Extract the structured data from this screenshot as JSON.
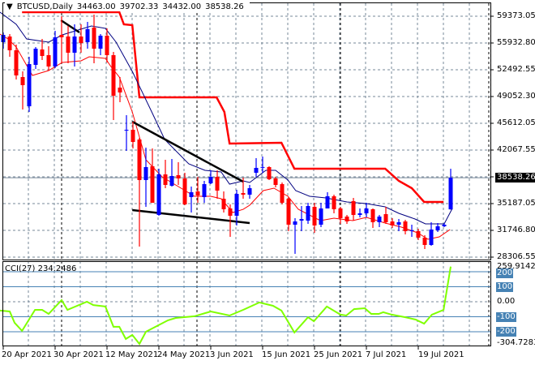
{
  "header": {
    "symbol": "BTCUSD,Daily",
    "open": "34463.00",
    "high": "39702.33",
    "low": "34432.00",
    "close": "38538.26"
  },
  "cci_label": {
    "name": "CCI(27)",
    "value": "234.2486"
  },
  "price_axis": [
    "59373.05",
    "55932.80",
    "52492.55",
    "49052.30",
    "45612.05",
    "42067.55",
    "35187.05",
    "31746.80",
    "28306.55"
  ],
  "current_price": "38538.26",
  "cci_axis": {
    "max": "259.9142",
    "min": "-304.7283",
    "levels": [
      "200",
      "100",
      "0.00",
      "-100",
      "-200"
    ]
  },
  "date_axis": [
    "20 Apr 2021",
    "30 Apr 2021",
    "12 May 2021",
    "24 May 2021",
    "3 Jun 2021",
    "15 Jun 2021",
    "25 Jun 2021",
    "7 Jul 2021",
    "19 Jul 2021"
  ],
  "colors": {
    "bull": "#0000ff",
    "bear": "#ff0000",
    "ma_fast": "#000080",
    "ma_slow": "#ff0000",
    "stop": "#ff0000",
    "cci": "#7fff00",
    "level": "#4682b4"
  },
  "chart_data": {
    "type": "candlestick",
    "title": "BTCUSD,Daily",
    "ylim": [
      28306.55,
      59373.05
    ],
    "candles": [
      [
        56026,
        57281,
        55189,
        56967
      ],
      [
        56758,
        57072,
        54143,
        54980
      ],
      [
        54980,
        55712,
        51214,
        51737
      ],
      [
        51528,
        52260,
        47344,
        50482
      ],
      [
        47762,
        54143,
        47030,
        53202
      ],
      [
        53097,
        55398,
        52574,
        55189
      ],
      [
        55084,
        56444,
        53725,
        54248
      ],
      [
        54352,
        55503,
        52365,
        52888
      ],
      [
        52888,
        57490,
        52679,
        56653
      ],
      [
        56967,
        59373,
        53306,
        56653
      ],
      [
        56758,
        58118,
        53306,
        54666
      ],
      [
        54666,
        58327,
        52888,
        56758
      ],
      [
        56758,
        58327,
        54666,
        55921
      ],
      [
        56026,
        58641,
        55189,
        57699
      ],
      [
        57909,
        59582,
        53306,
        55189
      ],
      [
        55189,
        57072,
        54352,
        56862
      ],
      [
        56862,
        57804,
        53411,
        54352
      ],
      [
        54352,
        54771,
        45985,
        49122
      ],
      [
        50168,
        51528,
        48285,
        49541
      ],
      [
        44624,
        46612,
        42009,
        44729
      ],
      [
        44729,
        45775,
        42323,
        43160
      ],
      [
        43474,
        43683,
        29667,
        38244
      ],
      [
        38244,
        42428,
        34792,
        39918
      ],
      [
        40022,
        42323,
        35315,
        35315
      ],
      [
        33746,
        39708,
        33641,
        38976
      ],
      [
        38976,
        40859,
        37198,
        37616
      ],
      [
        37511,
        40963,
        37407,
        38767
      ],
      [
        38871,
        40545,
        37616,
        38453
      ],
      [
        38453,
        39185,
        35001,
        35106
      ],
      [
        36047,
        37407,
        34060,
        36675
      ],
      [
        36779,
        38662,
        35315,
        36257
      ],
      [
        36047,
        38139,
        35315,
        37720
      ],
      [
        37825,
        39499,
        37720,
        38662
      ],
      [
        38662,
        39499,
        35838,
        36884
      ],
      [
        35838,
        36779,
        34060,
        34480
      ],
      [
        34583,
        35106,
        30922,
        33641
      ],
      [
        33641,
        36989,
        32386,
        36466
      ],
      [
        36570,
        38557,
        35838,
        36361
      ],
      [
        36361,
        37616,
        35838,
        37198
      ],
      [
        39185,
        41068,
        38662,
        39813
      ],
      [
        39918,
        41277,
        39185,
        39930
      ],
      [
        39918,
        40022,
        38244,
        38348
      ],
      [
        38453,
        38662,
        37302,
        37616
      ],
      [
        37720,
        37930,
        35106,
        35315
      ],
      [
        35838,
        36047,
        31654,
        32491
      ],
      [
        32491,
        33328,
        28730,
        32909
      ],
      [
        33014,
        34897,
        31654,
        33223
      ],
      [
        33014,
        35315,
        32595,
        34897
      ],
      [
        34792,
        35315,
        31445,
        32386
      ],
      [
        32491,
        35315,
        32177,
        34583
      ],
      [
        34583,
        36675,
        34583,
        36152
      ],
      [
        36152,
        36361,
        33955,
        34478
      ],
      [
        34583,
        34792,
        32595,
        33328
      ],
      [
        33537,
        33746,
        32595,
        32909
      ],
      [
        35524,
        35943,
        33014,
        33746
      ],
      [
        33746,
        34583,
        33432,
        33955
      ],
      [
        33955,
        35315,
        33432,
        34583
      ],
      [
        34478,
        34583,
        32073,
        32805
      ],
      [
        32805,
        33746,
        32177,
        33537
      ],
      [
        33851,
        34792,
        32595,
        32805
      ],
      [
        32909,
        33328,
        32073,
        32386
      ],
      [
        32491,
        33223,
        31654,
        32805
      ],
      [
        32909,
        33119,
        31236,
        31654
      ],
      [
        31654,
        32491,
        30922,
        31759
      ],
      [
        31654,
        31968,
        30504,
        30818
      ],
      [
        30818,
        31131,
        29353,
        29877
      ],
      [
        29877,
        32805,
        29772,
        31863
      ],
      [
        31759,
        32700,
        31550,
        32282
      ],
      [
        32282,
        32700,
        32177,
        32491
      ],
      [
        34463,
        39702.33,
        34432,
        38538.26
      ]
    ],
    "ma_fast": [
      [
        -0.5,
        59896
      ],
      [
        2,
        58327
      ],
      [
        3.6,
        56444
      ],
      [
        7,
        56026
      ],
      [
        9.1,
        56967
      ],
      [
        13.6,
        58118
      ],
      [
        15.75,
        57804
      ],
      [
        17.4,
        56026
      ],
      [
        19.9,
        52260
      ],
      [
        22.9,
        47030
      ],
      [
        24.9,
        43474
      ],
      [
        28.6,
        40336
      ],
      [
        31.1,
        39499
      ],
      [
        33.6,
        39290
      ],
      [
        34.9,
        37720
      ],
      [
        37,
        38139
      ],
      [
        38,
        37930
      ],
      [
        40.5,
        39499
      ],
      [
        42,
        39499
      ],
      [
        43.9,
        38244
      ],
      [
        45.1,
        36884
      ],
      [
        47.25,
        36152
      ],
      [
        49.75,
        35943
      ],
      [
        53,
        35420
      ],
      [
        56,
        35211
      ],
      [
        58.9,
        34792
      ],
      [
        61,
        33955
      ],
      [
        63.5,
        33223
      ],
      [
        65.1,
        32595
      ],
      [
        68,
        32595
      ],
      [
        69.25,
        34583
      ]
    ],
    "ma_slow": [
      [
        -0.5,
        57072
      ],
      [
        0.75,
        56444
      ],
      [
        2,
        55398
      ],
      [
        4.5,
        51737
      ],
      [
        7,
        52365
      ],
      [
        9.1,
        53411
      ],
      [
        12,
        53620
      ],
      [
        13.25,
        54143
      ],
      [
        15.75,
        53934
      ],
      [
        16.6,
        52888
      ],
      [
        17.9,
        51528
      ],
      [
        19.9,
        47030
      ],
      [
        22,
        40859
      ],
      [
        24.5,
        38662
      ],
      [
        27,
        37407
      ],
      [
        29.5,
        36152
      ],
      [
        32,
        36152
      ],
      [
        33.6,
        35838
      ],
      [
        35.4,
        34060
      ],
      [
        37,
        34463
      ],
      [
        38,
        35001
      ],
      [
        40.1,
        36884
      ],
      [
        41.75,
        37198
      ],
      [
        43.9,
        36152
      ],
      [
        45.5,
        34479
      ],
      [
        48.9,
        33014
      ],
      [
        51,
        33328
      ],
      [
        53.9,
        33014
      ],
      [
        56,
        33432
      ],
      [
        58.9,
        32700
      ],
      [
        61.4,
        32177
      ],
      [
        63.9,
        31445
      ],
      [
        65.5,
        30608
      ],
      [
        67.25,
        30922
      ],
      [
        68.9,
        31863
      ]
    ],
    "trailing_stop": [
      [
        2.9,
        59896
      ],
      [
        17.9,
        59896
      ],
      [
        18.6,
        58327
      ],
      [
        19.9,
        58223
      ],
      [
        21,
        48913
      ],
      [
        32.9,
        48913
      ],
      [
        34.1,
        47030
      ],
      [
        34.9,
        42951
      ],
      [
        42.9,
        43055
      ],
      [
        44.9,
        39708
      ],
      [
        58.9,
        39708
      ],
      [
        61,
        38139
      ],
      [
        63,
        37198
      ],
      [
        64.9,
        35420
      ],
      [
        67.9,
        35420
      ]
    ],
    "trendlines": [
      [
        [
          8.9,
          58850
        ],
        [
          11.75,
          57281
        ]
      ],
      [
        [
          19.9,
          45775
        ],
        [
          37,
          38035
        ]
      ],
      [
        [
          19.9,
          34374
        ],
        [
          38,
          32700
        ]
      ]
    ],
    "cci": {
      "period": 27,
      "ylim": [
        -304.7283,
        259.9142
      ],
      "levels": [
        200,
        100,
        0,
        -100,
        -200
      ],
      "points": [
        [
          -0.5,
          -59
        ],
        [
          1,
          -65
        ],
        [
          1.75,
          -140
        ],
        [
          2.9,
          -194
        ],
        [
          4.9,
          -54
        ],
        [
          6,
          -54
        ],
        [
          7,
          -81
        ],
        [
          9,
          11
        ],
        [
          9.9,
          -54
        ],
        [
          12.9,
          0
        ],
        [
          13.9,
          -22
        ],
        [
          15.75,
          -32
        ],
        [
          17,
          -167
        ],
        [
          17.9,
          -167
        ],
        [
          18.9,
          -248
        ],
        [
          19.9,
          -221
        ],
        [
          21,
          -281
        ],
        [
          22,
          -200
        ],
        [
          25.4,
          -124
        ],
        [
          26.6,
          -108
        ],
        [
          29.5,
          -97
        ],
        [
          32,
          -65
        ],
        [
          34.9,
          -92
        ],
        [
          37,
          -54
        ],
        [
          39.5,
          -5
        ],
        [
          41.6,
          -27
        ],
        [
          42.9,
          -59
        ],
        [
          44.9,
          -205
        ],
        [
          47,
          -103
        ],
        [
          47.9,
          -130
        ],
        [
          49.9,
          -32
        ],
        [
          52,
          -86
        ],
        [
          52.9,
          -92
        ],
        [
          54.1,
          -49
        ],
        [
          55.75,
          -43
        ],
        [
          56.75,
          -81
        ],
        [
          57.9,
          -81
        ],
        [
          58.6,
          -70
        ],
        [
          59.9,
          -86
        ],
        [
          62,
          -103
        ],
        [
          63.6,
          -119
        ],
        [
          64.9,
          -146
        ],
        [
          66.1,
          -86
        ],
        [
          67.9,
          -54
        ],
        [
          69,
          234.2486
        ]
      ]
    },
    "date_ticks_bar_index": [
      0,
      8,
      16,
      24,
      32,
      40,
      48,
      56,
      64
    ]
  }
}
